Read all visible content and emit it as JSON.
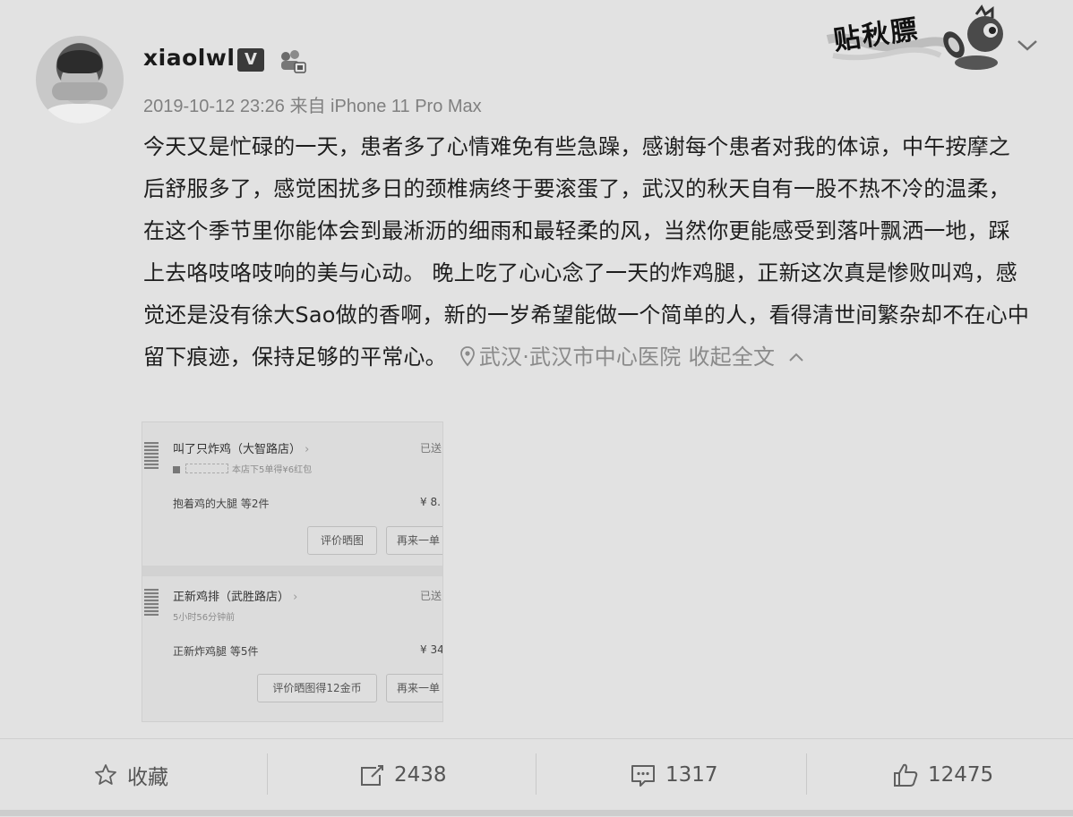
{
  "post": {
    "username": "xiaolwl",
    "verified_badge": "V",
    "timestamp": "2019-10-12 23:26",
    "source": "来自 iPhone 11 Pro Max",
    "text": "今天又是忙碌的一天，患者多了心情难免有些急躁，感谢每个患者对我的体谅，中午按摩之后舒服多了，感觉困扰多日的颈椎病终于要滚蛋了，武汉的秋天自有一股不热不冷的温柔，在这个季节里你能体会到最淅沥的细雨和最轻柔的风，当然你更能感受到落叶飘洒一地，踩上去咯吱咯吱响的美与心动。 晚上吃了心心念了一天的炸鸡腿，正新这次真是惨败叫鸡，感觉还是没有徐大Sao做的香啊，新的一岁希望能做一个简单的人，看得清世间繁杂却不在心中留下痕迹，保持足够的平常心。",
    "location": "武汉·武汉市中心医院",
    "collapse_label": "收起全文",
    "sticker_text": "贴秋膘",
    "icons": {
      "verified": "verified-v-icon",
      "member": "member-icon",
      "location": "location-pin-icon",
      "collapse": "chevron-up-icon",
      "menu": "chevron-down-icon"
    }
  },
  "attached_image": {
    "orders": [
      {
        "store": "叫了只炸鸡（大智路店）",
        "status": "已送",
        "subline": "本店下5单得¥6红包",
        "item": "抱着鸡的大腿 等2件",
        "price": "¥ 8.",
        "buttons": [
          "评价晒图",
          "再来一单"
        ]
      },
      {
        "store": "正新鸡排（武胜路店）",
        "status": "已送",
        "subline": "5小时56分钟前",
        "item": "正新炸鸡腿 等5件",
        "price": "¥ 34",
        "buttons": [
          "评价晒图得12金币",
          "再来一单"
        ]
      }
    ]
  },
  "actions": {
    "favorite": {
      "label": "收藏",
      "icon": "star-icon"
    },
    "repost": {
      "count": "2438",
      "icon": "share-icon"
    },
    "comment": {
      "count": "1317",
      "icon": "comment-icon"
    },
    "like": {
      "count": "12475",
      "icon": "thumbs-up-icon"
    }
  },
  "colors": {
    "background": "#e2e2e2",
    "text_primary": "#1e1e1e",
    "text_secondary": "#808080"
  }
}
